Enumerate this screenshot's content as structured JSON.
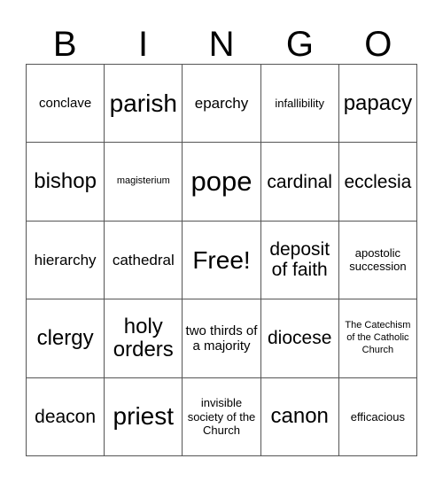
{
  "card": {
    "header": {
      "letters": [
        "B",
        "I",
        "N",
        "G",
        "O"
      ]
    },
    "grid": {
      "rows": 5,
      "columns": 5,
      "border_color": "#555555",
      "cell_background": "#ffffff",
      "text_color": "#000000",
      "cells": [
        {
          "text": "conclave",
          "size": "md",
          "row": 1,
          "col": 1
        },
        {
          "text": "parish",
          "size": "3xl",
          "row": 1,
          "col": 2
        },
        {
          "text": "eparchy",
          "size": "lg",
          "row": 1,
          "col": 3
        },
        {
          "text": "infallibility",
          "size": "sm",
          "row": 1,
          "col": 4
        },
        {
          "text": "papacy",
          "size": "2xl",
          "row": 1,
          "col": 5
        },
        {
          "text": "bishop",
          "size": "2xl",
          "row": 2,
          "col": 1
        },
        {
          "text": "magisterium",
          "size": "xs",
          "row": 2,
          "col": 2
        },
        {
          "text": "pope",
          "size": "4xl",
          "row": 2,
          "col": 3
        },
        {
          "text": "cardinal",
          "size": "xl",
          "row": 2,
          "col": 4
        },
        {
          "text": "ecclesia",
          "size": "xl",
          "row": 2,
          "col": 5
        },
        {
          "text": "hierarchy",
          "size": "lg",
          "row": 3,
          "col": 1
        },
        {
          "text": "cathedral",
          "size": "lg",
          "row": 3,
          "col": 2
        },
        {
          "text": "Free!",
          "size": "3xl",
          "row": 3,
          "col": 3
        },
        {
          "text": "deposit of faith",
          "size": "xl",
          "row": 3,
          "col": 4
        },
        {
          "text": "apostolic succession",
          "size": "sm",
          "row": 3,
          "col": 5
        },
        {
          "text": "clergy",
          "size": "2xl",
          "row": 4,
          "col": 1
        },
        {
          "text": "holy orders",
          "size": "2xl",
          "row": 4,
          "col": 2
        },
        {
          "text": "two thirds of a majority",
          "size": "md",
          "row": 4,
          "col": 3
        },
        {
          "text": "diocese",
          "size": "xl",
          "row": 4,
          "col": 4
        },
        {
          "text": "The Catechism of the Catholic Church",
          "size": "xs",
          "row": 4,
          "col": 5
        },
        {
          "text": "deacon",
          "size": "xl",
          "row": 5,
          "col": 1
        },
        {
          "text": "priest",
          "size": "3xl",
          "row": 5,
          "col": 2
        },
        {
          "text": "invisible society of the Church",
          "size": "sm",
          "row": 5,
          "col": 3
        },
        {
          "text": "canon",
          "size": "2xl",
          "row": 5,
          "col": 4
        },
        {
          "text": "efficacious",
          "size": "sm",
          "row": 5,
          "col": 5
        }
      ]
    }
  }
}
